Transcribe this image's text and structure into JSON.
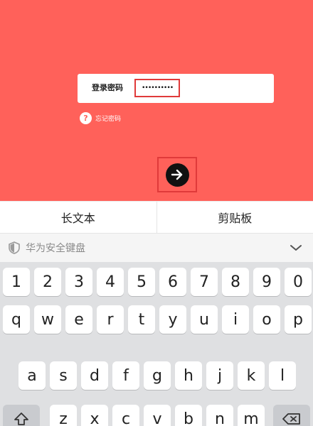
{
  "login": {
    "password_label": "登录密码",
    "password_value": "••••••••••",
    "forgot_icon_glyph": "?",
    "forgot_label": "忘记密码"
  },
  "clipboard_bar": {
    "items": [
      "长文本",
      "剪贴板"
    ]
  },
  "keyboard": {
    "title": "华为安全键盘",
    "rows": {
      "numbers": [
        "1",
        "2",
        "3",
        "4",
        "5",
        "6",
        "7",
        "8",
        "9",
        "0"
      ],
      "row1": [
        "q",
        "w",
        "e",
        "r",
        "t",
        "y",
        "u",
        "i",
        "o",
        "p"
      ],
      "row2": [
        "a",
        "s",
        "d",
        "f",
        "g",
        "h",
        "j",
        "k",
        "l"
      ],
      "row3": [
        "z",
        "x",
        "c",
        "v",
        "b",
        "n",
        "m"
      ]
    }
  },
  "colors": {
    "background": "#ff615a",
    "highlight_border": "#e03a3a",
    "submit_button": "#111111"
  }
}
